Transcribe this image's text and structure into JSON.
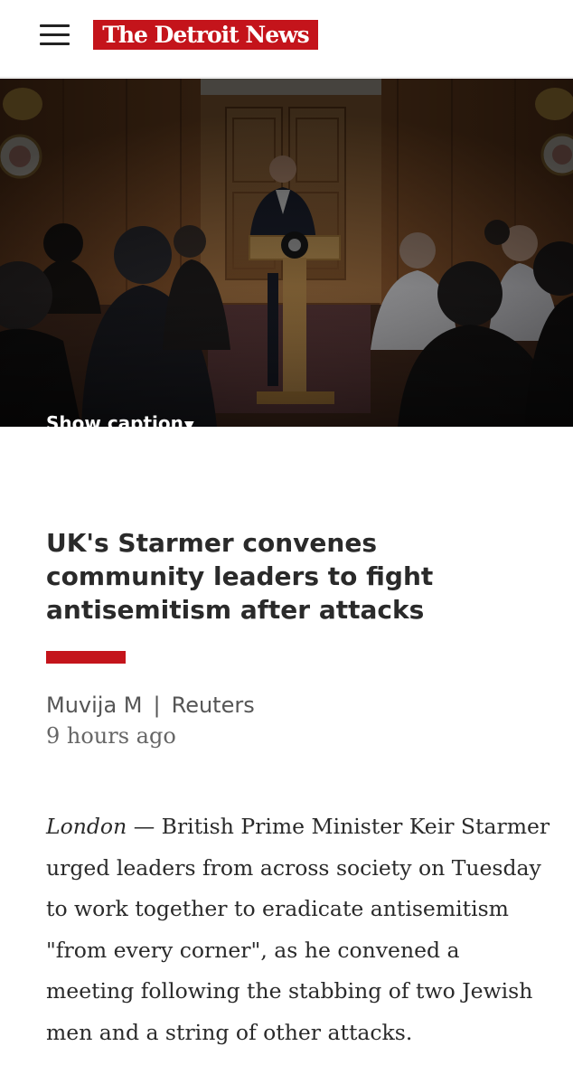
{
  "header": {
    "logo_text": "The Detroit News",
    "menu_icon": "hamburger-menu-icon",
    "brand_color": "#c4141b"
  },
  "hero": {
    "caption_toggle_label": "Show caption",
    "caption_toggle_icon": "caret-down-icon"
  },
  "article": {
    "headline": "UK's Starmer convenes community leaders to fight antisemitism after attacks",
    "author": "Muvija M",
    "separator": "|",
    "source": "Reuters",
    "timestamp": "9 hours ago",
    "dateline": "London",
    "dash": " — ",
    "lede": "British Prime Minister Keir Starmer urged leaders from across society on Tuesday to work together to eradicate antisemitism \"from every corner\", as he convened a meeting following the stabbing of two Jewish men and a string of other attacks."
  }
}
